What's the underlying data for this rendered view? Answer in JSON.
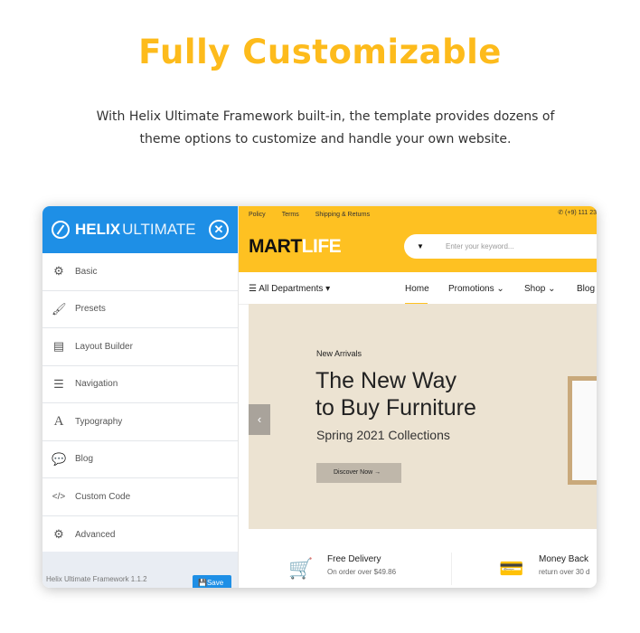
{
  "heading": "Fully Customizable",
  "description": "With Helix Ultimate Framework built-in, the template provides dozens of theme options to customize and handle your own website.",
  "sidebar": {
    "brand_bold": "HELIX",
    "brand_light": "ULTIMATE",
    "items": [
      {
        "label": "Basic",
        "icon": "gear-icon"
      },
      {
        "label": "Presets",
        "icon": "brush-icon"
      },
      {
        "label": "Layout Builder",
        "icon": "layout-icon"
      },
      {
        "label": "Navigation",
        "icon": "list-icon"
      },
      {
        "label": "Typography",
        "icon": "font-icon"
      },
      {
        "label": "Blog",
        "icon": "comments-icon"
      },
      {
        "label": "Custom Code",
        "icon": "code-icon"
      },
      {
        "label": "Advanced",
        "icon": "gear-icon"
      }
    ],
    "version": "Helix Ultimate Framework 1.1.2",
    "save": "Save"
  },
  "site": {
    "topbar": [
      "Policy",
      "Terms",
      "Shipping & Returns"
    ],
    "phone": "(+9) 111 23",
    "logo_dark": "MART",
    "logo_light": "LIFE",
    "search_placeholder": "Enter your keyword...",
    "departments": "All Departments",
    "nav": [
      "Home",
      "Promotions",
      "Shop",
      "Blog"
    ],
    "hero": {
      "kicker": "New Arrivals",
      "title_line1": "The New Way",
      "title_line2": "to Buy Furniture",
      "subtitle": "Spring 2021 Collections",
      "button": "Discover Now"
    },
    "features": [
      {
        "title": "Free Delivery",
        "text": "On order over $49.86"
      },
      {
        "title": "Money Back",
        "text": "return over 30 d"
      }
    ]
  },
  "colors": {
    "accent": "#fdbb1c",
    "helix_blue": "#1e8fe6",
    "hero_bg": "#ece3d2"
  }
}
